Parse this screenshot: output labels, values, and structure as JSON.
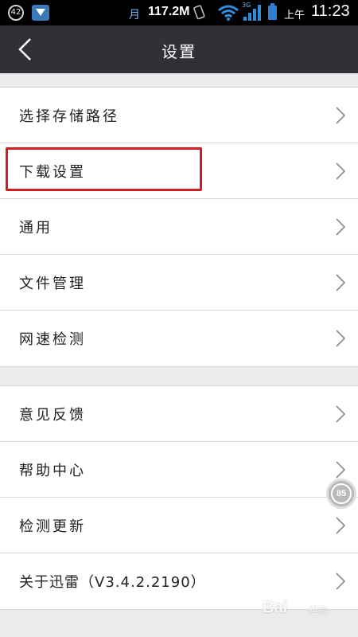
{
  "status_bar": {
    "notification_count": "42",
    "sim_label": "月",
    "net_speed": "117.2M",
    "signal_label": "3G",
    "ampm": "上午",
    "time": "11:23"
  },
  "header": {
    "title": "设置",
    "back_icon": "chevron-left-icon"
  },
  "groups": [
    {
      "items": [
        {
          "label": "选择存储路径"
        },
        {
          "label": "下载设置"
        },
        {
          "label": "通用"
        },
        {
          "label": "文件管理"
        },
        {
          "label": "网速检测"
        }
      ]
    },
    {
      "items": [
        {
          "label": "意见反馈"
        },
        {
          "label": "帮助中心"
        },
        {
          "label": "检测更新"
        },
        {
          "label": "关于迅雷（V3.4.2.2190）"
        }
      ]
    }
  ],
  "highlighted_item": "下载设置",
  "floating_badge": "85",
  "watermark": {
    "text": "Bai",
    "suffix": "经验"
  },
  "colors": {
    "header_bg": "#2f3136",
    "page_bg": "#ebebeb",
    "highlight": "#cc1f1f"
  }
}
